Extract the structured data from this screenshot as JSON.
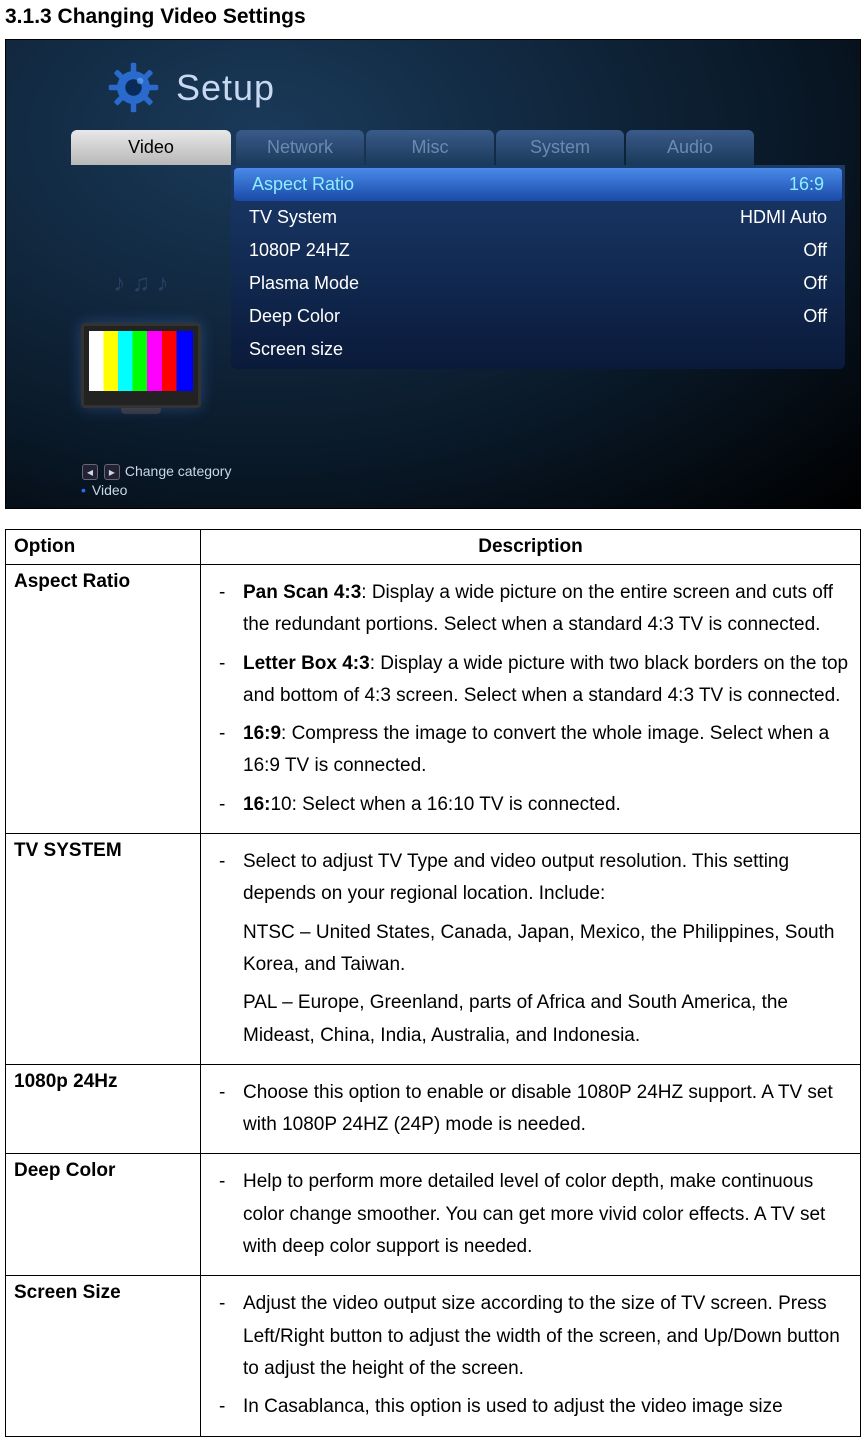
{
  "section_title": "3.1.3 Changing Video Settings",
  "screenshot": {
    "header_label": "Setup",
    "tabs": {
      "active": "Video",
      "inactive": [
        "Network",
        "Misc",
        "System",
        "Audio"
      ]
    },
    "settings": [
      {
        "label": "Aspect Ratio",
        "value": "16:9",
        "selected": true
      },
      {
        "label": "TV System",
        "value": "HDMI Auto",
        "selected": false
      },
      {
        "label": "1080P 24HZ",
        "value": "Off",
        "selected": false
      },
      {
        "label": "Plasma Mode",
        "value": "Off",
        "selected": false
      },
      {
        "label": "Deep Color",
        "value": "Off",
        "selected": false
      },
      {
        "label": "Screen size",
        "value": "",
        "selected": false
      }
    ],
    "footer": {
      "hint": "Change category",
      "sub": "Video"
    }
  },
  "table": {
    "headers": {
      "option": "Option",
      "description": "Description"
    },
    "rows": {
      "aspect_ratio": {
        "option": "Aspect Ratio",
        "items": [
          {
            "bold": "Pan Scan 4:3",
            "text": ": Display a wide picture on the entire screen and cuts off the redundant portions. Select when a standard 4:3 TV is connected."
          },
          {
            "bold": "Letter Box 4:3",
            "text": ": Display a wide picture with two black borders on the top and bottom of 4:3 screen. Select when a standard 4:3 TV is connected."
          },
          {
            "bold": "16:9",
            "text": ": Compress the image to convert the whole image. Select when a 16:9 TV is connected."
          },
          {
            "bold": "16:",
            "text": "10: Select when a 16:10 TV is connected."
          }
        ]
      },
      "tv_system": {
        "option": "TV SYSTEM",
        "intro": "Select to adjust TV Type and video output resolution. This setting depends on your regional location. Include:",
        "ntsc_bold": "NTSC",
        "ntsc_text": " – United States, Canada, Japan, Mexico, the Philippines, South Korea, and Taiwan.",
        "pal_bold": "PAL",
        "pal_text": " – Europe, Greenland, parts of Africa and South America, the Mideast, China, India, Australia, and Indonesia."
      },
      "p1080": {
        "option": "1080p 24Hz",
        "text": "Choose this option to enable or disable 1080P 24HZ support. A TV set with 1080P 24HZ (24P) mode is needed."
      },
      "deep_color": {
        "option": "Deep Color",
        "text": "Help to perform more detailed level of color depth, make continuous color change smoother. You can get more vivid color effects. A TV set with deep color support is needed."
      },
      "screen_size": {
        "option": "Screen Size",
        "items": [
          "Adjust the video output size according to the size of TV screen. Press Left/Right button to adjust the width of the screen, and Up/Down button to adjust the height of the screen.",
          "In Casablanca, this option is used to adjust the video image size"
        ]
      }
    }
  }
}
